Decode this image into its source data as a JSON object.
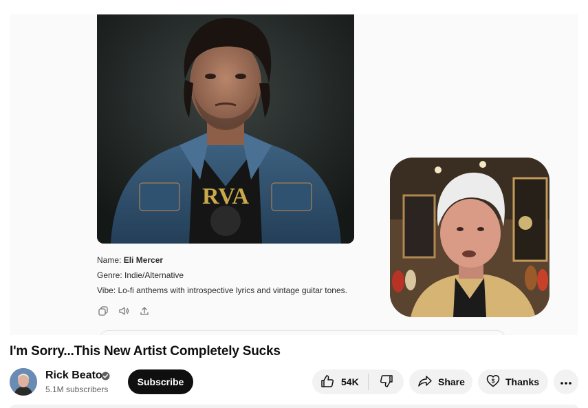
{
  "video": {
    "title": "I'm Sorry...This New Artist Completely Sucks"
  },
  "frame": {
    "name_label": "Name: ",
    "name_value": "Eli Mercer",
    "genre": "Genre: Indie/Alternative",
    "vibe": "Vibe: Lo-fi anthems with introspective lyrics and vintage guitar tones.",
    "shirt_text": "RVA",
    "icons": [
      "copy-icon",
      "speaker-icon",
      "upload-icon"
    ]
  },
  "channel": {
    "name": "Rick Beato",
    "subscribers": "5.1M subscribers",
    "subscribe_label": "Subscribe"
  },
  "actions": {
    "like_count": "54K",
    "share_label": "Share",
    "thanks_label": "Thanks"
  },
  "colors": {
    "subscribe_bg": "#0f0f0f",
    "pill_bg": "#f2f2f2",
    "text": "#0f0f0f",
    "secondary_text": "#606060"
  }
}
